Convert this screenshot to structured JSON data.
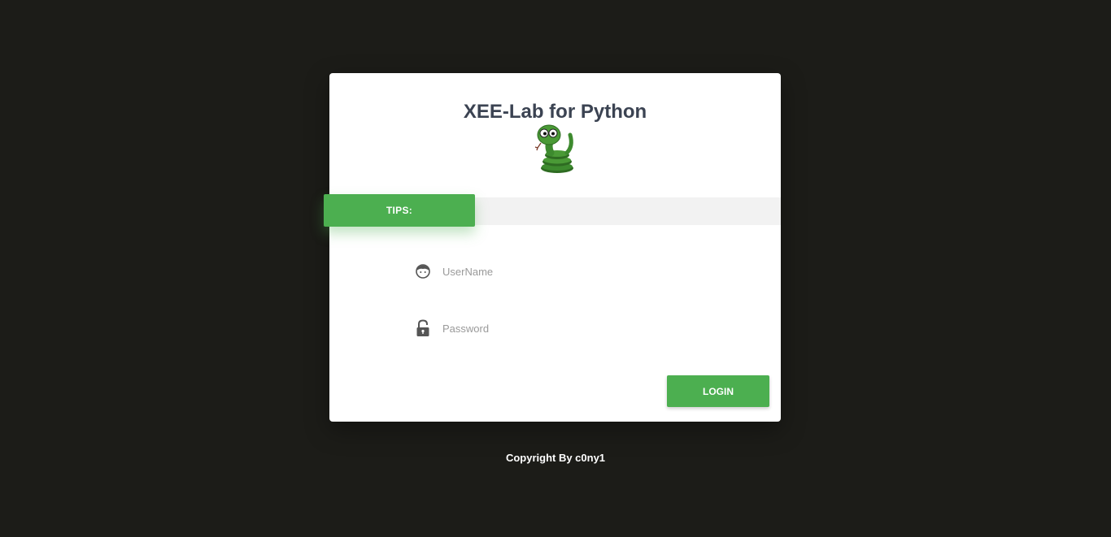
{
  "card": {
    "title": "XEE-Lab for Python",
    "logo_icon": "snake-mascot-icon"
  },
  "tips": {
    "label": "TIPS:",
    "message": ""
  },
  "form": {
    "username": {
      "placeholder": "UserName",
      "value": "",
      "icon": "user-face-icon"
    },
    "password": {
      "placeholder": "Password",
      "value": "",
      "icon": "unlocked-padlock-icon"
    },
    "login_label": "LOGIN"
  },
  "footer": {
    "copyright": "Copyright By c0ny1"
  },
  "colors": {
    "background": "#1c1c18",
    "accent": "#4caf50",
    "title": "#3b4352"
  }
}
